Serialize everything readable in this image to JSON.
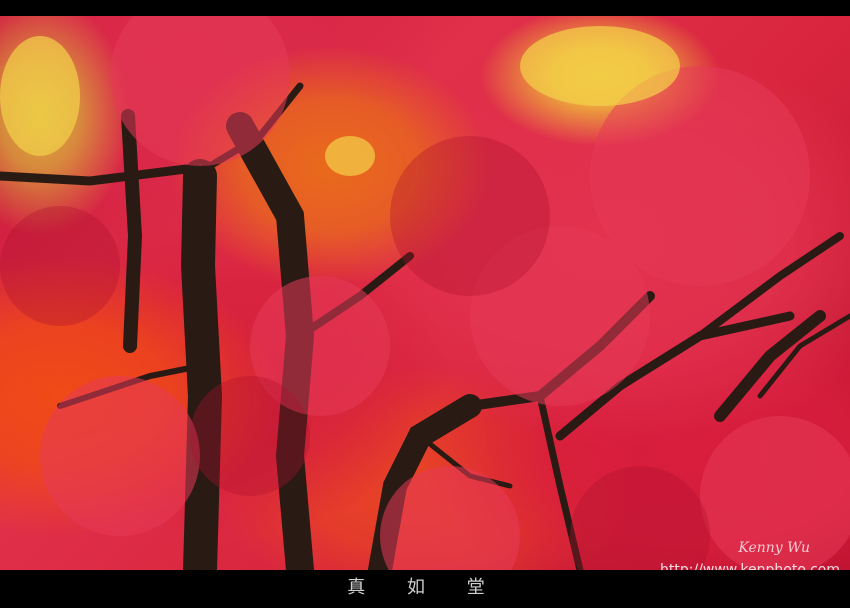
{
  "photo": {
    "subject": "maple-trees-autumn",
    "watermark_name": "Kenny Wu",
    "watermark_url": "http://www.kenphoto.com"
  },
  "caption": {
    "title": "真 如 堂"
  },
  "colors": {
    "frame": "#000000",
    "crimson": "#d6203c",
    "orange": "#f04a17",
    "yellow": "#f0c23a",
    "trunk": "#2a1a14"
  }
}
